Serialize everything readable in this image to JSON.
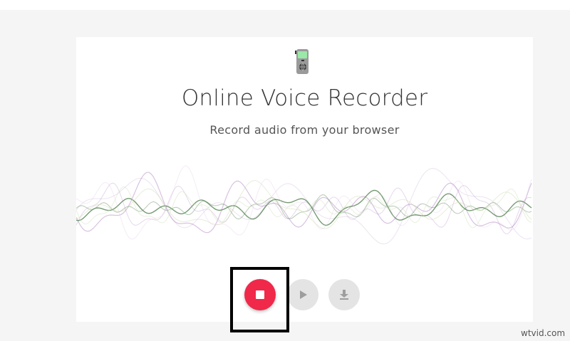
{
  "app": {
    "title": "Online Voice Recorder",
    "subtitle": "Record audio from your browser"
  },
  "controls": {
    "stop_icon": "stop-icon",
    "play_icon": "play-icon",
    "download_icon": "download-icon"
  },
  "colors": {
    "record_accent": "#f0284a",
    "disabled_button": "#e4e4e4",
    "wave_green": "#5d8a5a",
    "wave_purple": "#b890c8"
  },
  "watermark": "wtvid.com"
}
